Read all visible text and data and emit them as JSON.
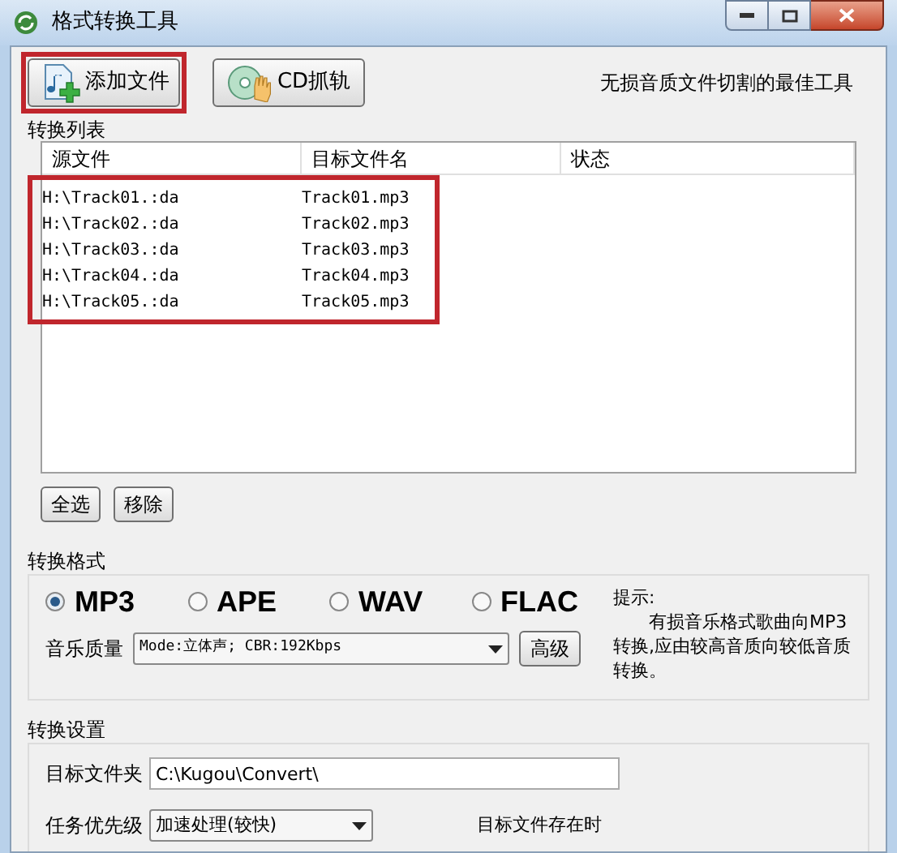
{
  "window": {
    "title": "格式转换工具"
  },
  "toolbar": {
    "buttons": [
      {
        "label": "添加文件",
        "kind": "add",
        "highlighted": true
      },
      {
        "label": "CD抓轨",
        "kind": "cd",
        "highlighted": false
      }
    ],
    "slogan": "无损音质文件切割的最佳工具"
  },
  "list": {
    "title": "转换列表",
    "columns": [
      "源文件",
      "目标文件名",
      "状态"
    ],
    "highlighted": true,
    "rows": [
      [
        "H:\\Track01.:da",
        "Track01.mp3"
      ],
      [
        "H:\\Track02.:da",
        "Track02.mp3"
      ],
      [
        "H:\\Track03.:da",
        "Track03.mp3"
      ],
      [
        "H:\\Track04.:da",
        "Track04.mp3"
      ],
      [
        "H:\\Track05.:da",
        "Track05.mp3"
      ]
    ],
    "buttons": [
      "全选",
      "移除"
    ]
  },
  "format": {
    "title": "转换格式",
    "options": [
      {
        "label": "MP3",
        "selected": true
      },
      {
        "label": "APE",
        "selected": false
      },
      {
        "label": "WAV",
        "selected": false
      },
      {
        "label": "FLAC",
        "selected": false
      }
    ],
    "quality_label": "音乐质量",
    "quality_value": "Mode:立体声; CBR:192Kbps",
    "advanced_button": "高级",
    "hint_title": "提示:",
    "hint_text": "有损音乐格式歌曲向MP3转换,应由较高音质向较低音质转换。"
  },
  "settings": {
    "title": "转换设置",
    "folder_label": "目标文件夹",
    "folder_value": "C:\\Kugou\\Convert\\",
    "priority_label": "任务优先级",
    "priority_value": "加速处理(较快)",
    "exists_label": "目标文件存在时"
  }
}
